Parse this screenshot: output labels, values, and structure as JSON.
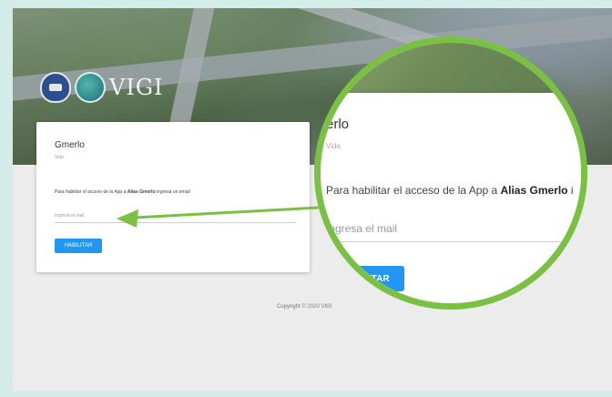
{
  "brand": {
    "logo_text": "VIGI"
  },
  "card": {
    "title": "Gmerlo",
    "subtitle": "Vida",
    "message_prefix": "Para habilitar el acceso de la App a ",
    "alias": "Alias Gmerlo",
    "message_suffix": " ingresá un email",
    "email_placeholder": "Ingresa el mail",
    "enable_button": "HABILITAR"
  },
  "footer": {
    "copyright": "Copyright © 2020 VIGI"
  },
  "zoom": {
    "title": "erlo",
    "subtitle": "Vida",
    "message_prefix": "Para habilitar el acceso de la App a ",
    "alias": "Alias Gmerlo",
    "message_suffix": " i",
    "email_placeholder": "Ingresa el mail",
    "enable_button": "HABILITAR"
  },
  "colors": {
    "accent": "#2196f3",
    "callout": "#7ac143"
  }
}
